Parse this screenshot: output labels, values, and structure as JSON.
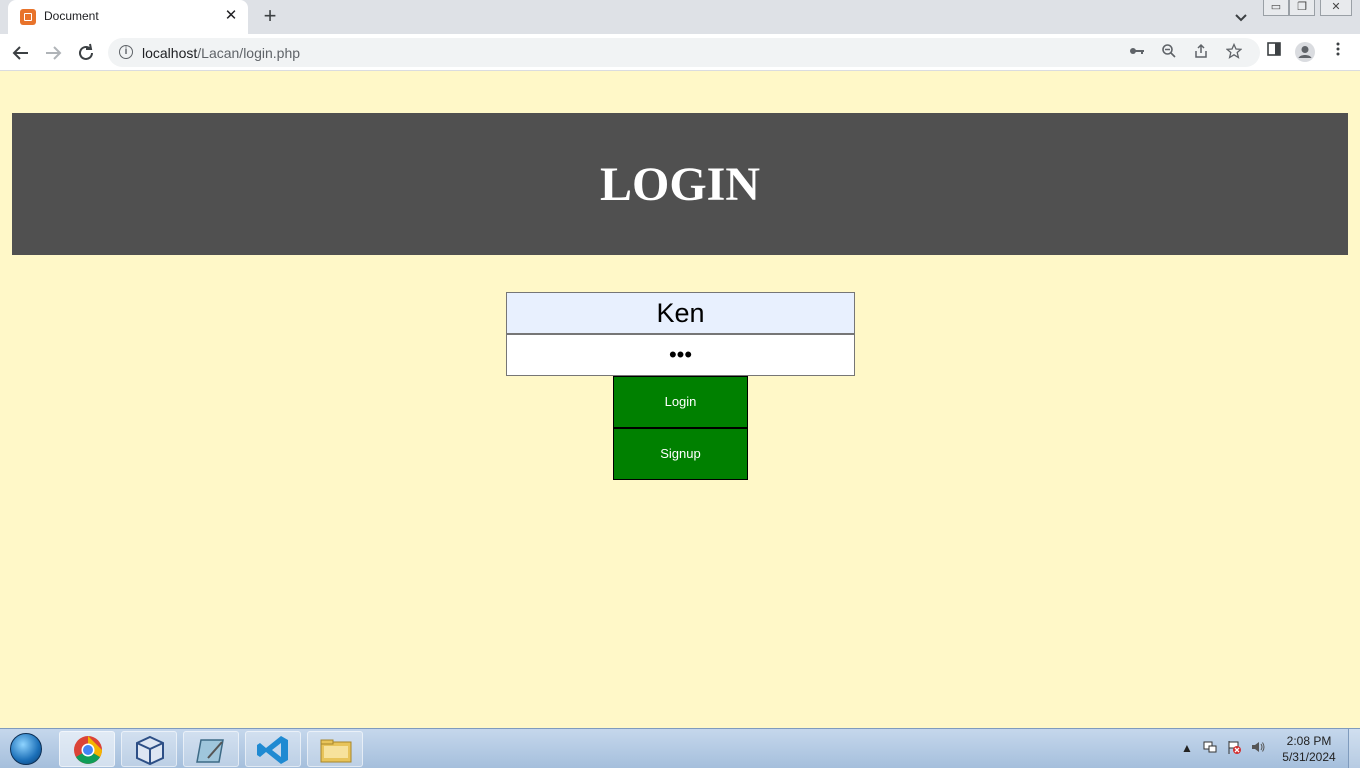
{
  "browser": {
    "tab_title": "Document",
    "tab_close": "✕",
    "new_tab": "+",
    "url_host": "localhost",
    "url_path": "/Lacan/login.php"
  },
  "page": {
    "header_title": "LOGIN",
    "username_value": "Ken",
    "password_mask": "•••",
    "login_label": "Login",
    "signup_label": "Signup"
  },
  "taskbar": {
    "time": "2:08 PM",
    "date": "5/31/2024"
  },
  "colors": {
    "page_bg": "#fff8c8",
    "header_bg": "#505050",
    "button_bg": "#008000",
    "username_bg": "#e8f0fe"
  }
}
